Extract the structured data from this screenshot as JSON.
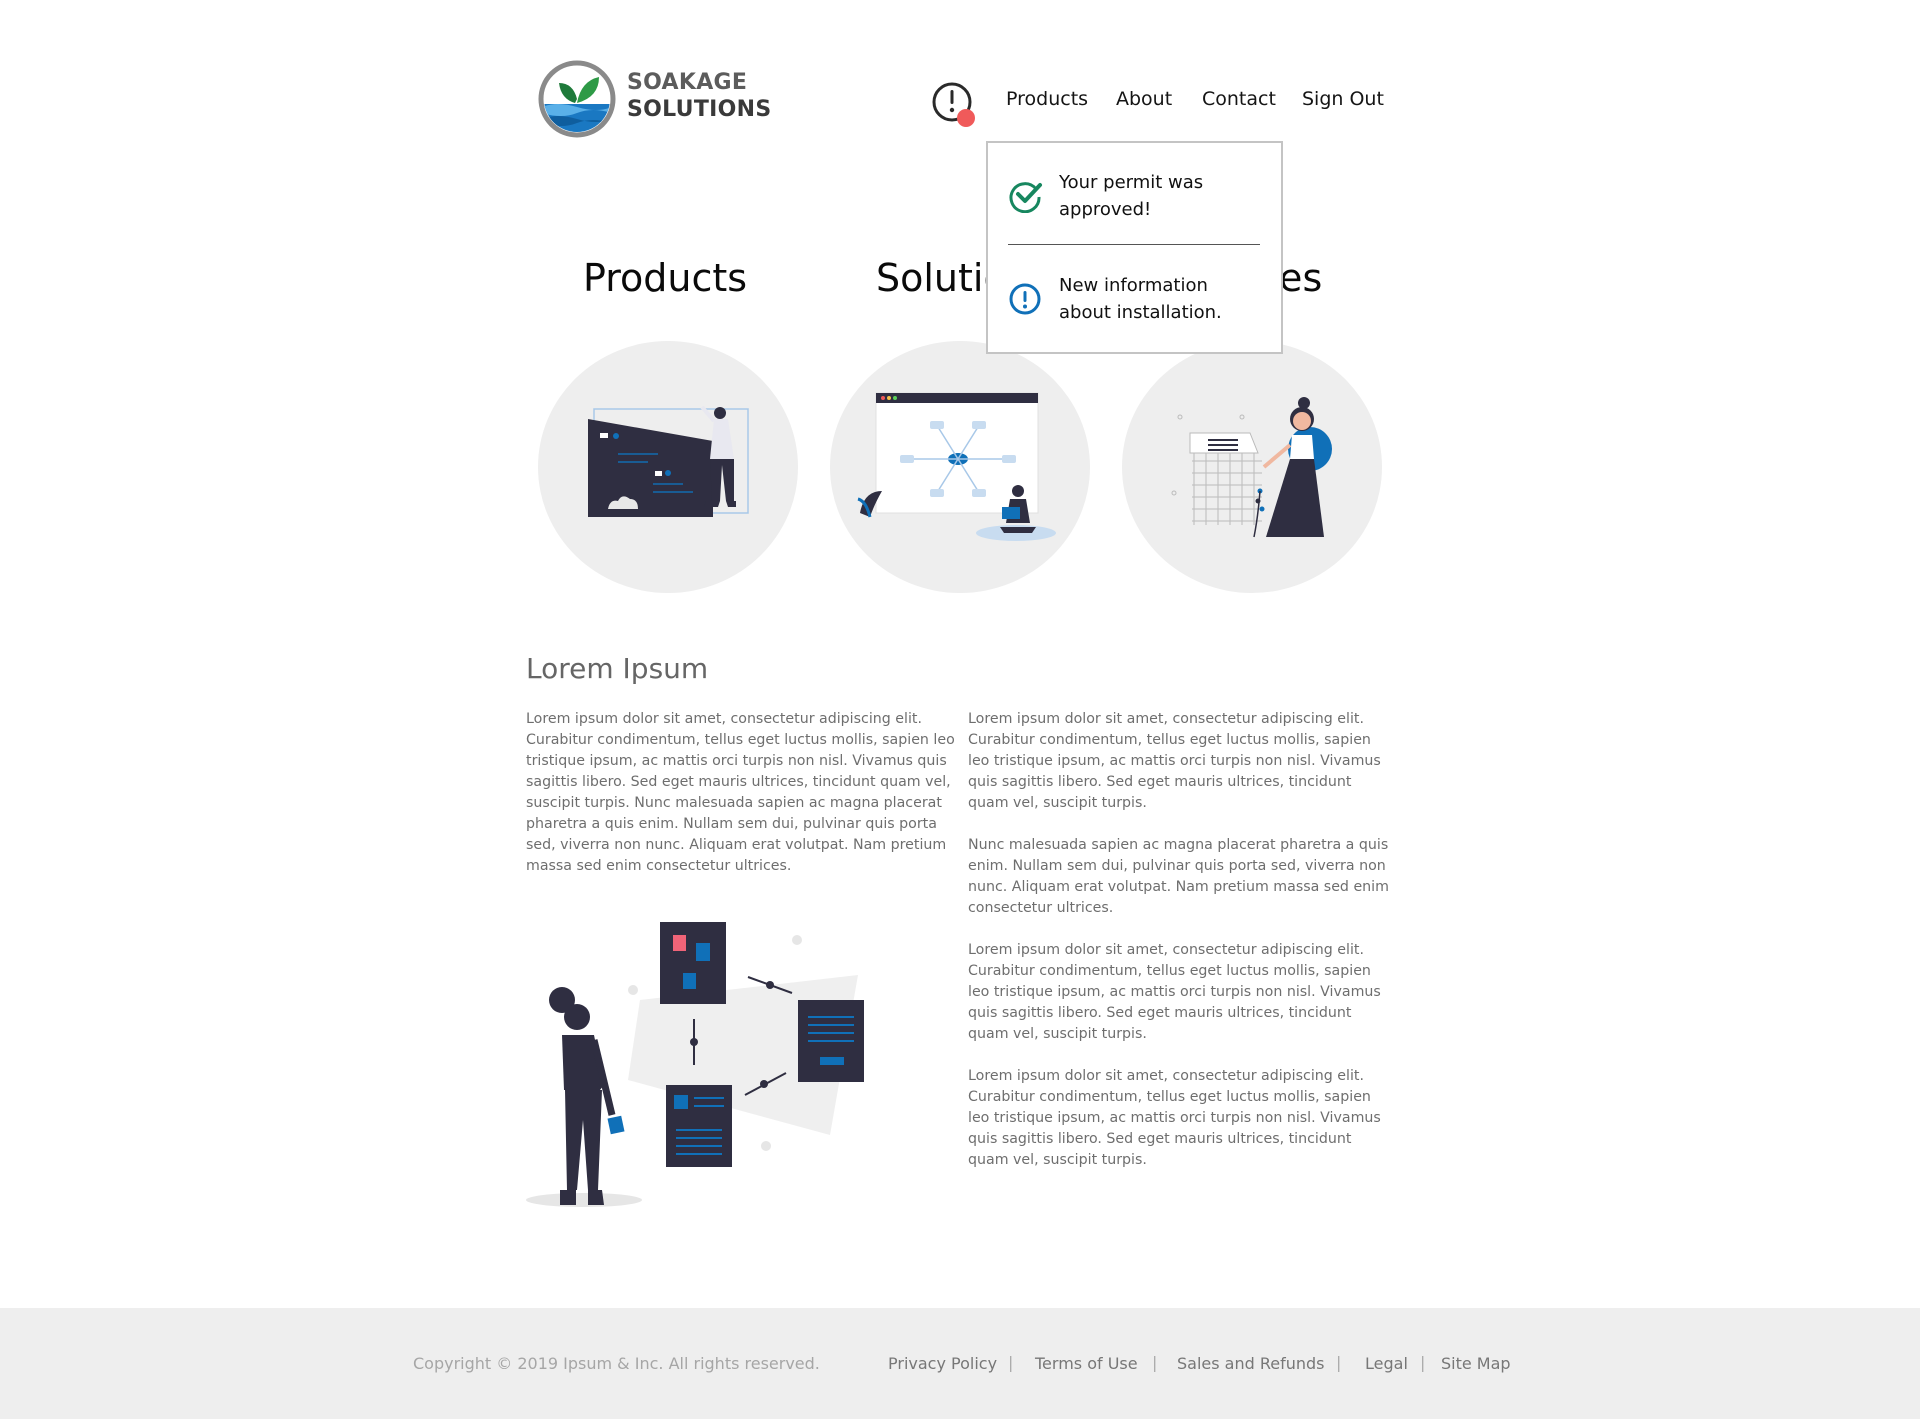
{
  "brand": {
    "line1": "SOAKAGE",
    "line2": "SOLUTIONS"
  },
  "nav": {
    "products": "Products",
    "about": "About",
    "contact": "Contact",
    "sign_out": "Sign Out",
    "notification_icon": "alert-circle-icon",
    "notification_dot_color": "#f05a5a"
  },
  "notifications": [
    {
      "icon": "check-circle-icon",
      "color": "#17875f",
      "line1": "Your permit was",
      "line2": "approved!"
    },
    {
      "icon": "info-circle-icon",
      "color": "#1070b8",
      "line1": "New information",
      "line2": "about installation."
    }
  ],
  "sections": [
    {
      "title": "Products"
    },
    {
      "title": "Solutions"
    },
    {
      "title": "Services"
    }
  ],
  "content": {
    "heading": "Lorem Ipsum",
    "left_paragraph": [
      "Lorem ipsum dolor sit amet, consectetur adipiscing elit.",
      "Curabitur condimentum, tellus eget luctus mollis, sapien leo",
      "tristique ipsum, ac mattis orci turpis non nisl. Vivamus quis",
      "sagittis libero. Sed eget mauris ultrices, tincidunt quam vel,",
      "suscipit turpis. Nunc malesuada sapien ac magna placerat",
      "pharetra a quis enim. Nullam sem dui, pulvinar quis porta",
      "sed, viverra non nunc. Aliquam erat volutpat. Nam pretium",
      "massa sed enim consectetur ultrices."
    ],
    "right_paragraphs": [
      [
        "Lorem ipsum dolor sit amet, consectetur adipiscing elit.",
        "Curabitur condimentum, tellus eget luctus mollis, sapien",
        "leo tristique ipsum, ac mattis orci turpis non nisl. Vivamus",
        "quis sagittis libero. Sed eget mauris ultrices, tincidunt",
        "quam vel, suscipit turpis."
      ],
      [
        "Nunc malesuada sapien ac magna placerat pharetra a quis",
        "enim. Nullam sem dui, pulvinar quis porta sed, viverra non",
        "nunc. Aliquam erat volutpat. Nam pretium massa sed enim",
        "consectetur ultrices."
      ],
      [
        "Lorem ipsum dolor sit amet, consectetur adipiscing elit.",
        "Curabitur condimentum, tellus eget luctus mollis, sapien",
        "leo tristique ipsum, ac mattis orci turpis non nisl. Vivamus",
        "quis sagittis libero. Sed eget mauris ultrices, tincidunt",
        "quam vel, suscipit turpis."
      ],
      [
        "Lorem ipsum dolor sit amet, consectetur adipiscing elit.",
        "Curabitur condimentum, tellus eget luctus mollis, sapien",
        "leo tristique ipsum, ac mattis orci turpis non nisl. Vivamus",
        "quis sagittis libero. Sed eget mauris ultrices, tincidunt",
        "quam vel, suscipit turpis."
      ]
    ]
  },
  "footer": {
    "copyright": "Copyright © 2019 Ipsum & Inc. All rights reserved.",
    "separator": "|",
    "links": [
      "Privacy Policy",
      "Terms of Use",
      "Sales and Refunds",
      "Legal",
      "Site Map"
    ]
  },
  "colors": {
    "accent_blue": "#1070b8",
    "dark_navy": "#2f2e41",
    "success_green": "#17875f",
    "footer_bg": "#eeeeee"
  }
}
